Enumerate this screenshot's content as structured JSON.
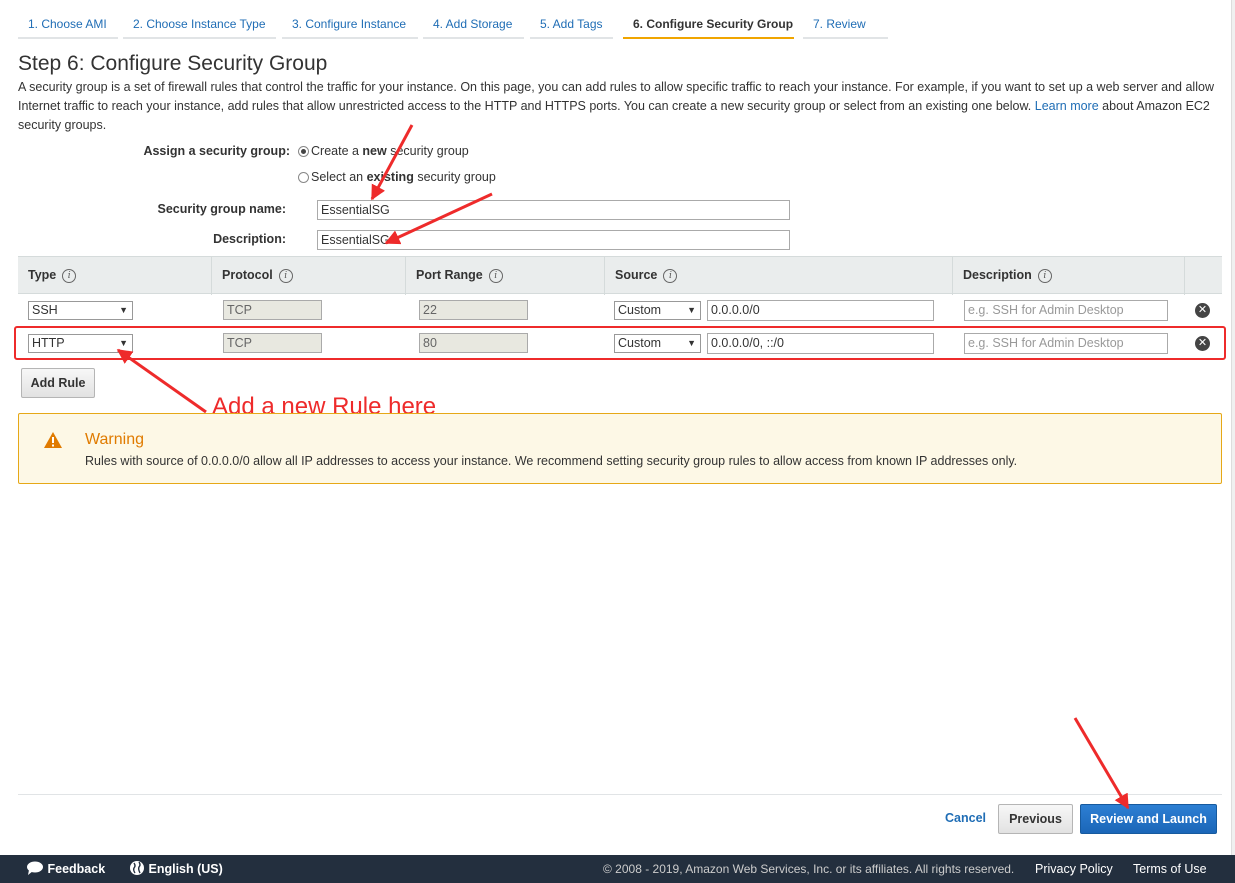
{
  "wizard": {
    "tabs": [
      {
        "label": "1. Choose AMI"
      },
      {
        "label": "2. Choose Instance Type"
      },
      {
        "label": "3. Configure Instance"
      },
      {
        "label": "4. Add Storage"
      },
      {
        "label": "5. Add Tags"
      },
      {
        "label": "6. Configure Security Group"
      },
      {
        "label": "7. Review"
      }
    ],
    "active_tab": 5
  },
  "page": {
    "title": "Step 6: Configure Security Group",
    "intro": "A security group is a set of firewall rules that control the traffic for your instance. On this page, you can add rules to allow specific traffic to reach your instance. For example, if you want to set up a web server and allow Internet traffic to reach your instance, add rules that allow unrestricted access to the HTTP and HTTPS ports. You can create a new security group or select from an existing one below.",
    "learn_more": "Learn more",
    "intro_tail": "about Amazon EC2 security groups."
  },
  "form": {
    "assign_label": "Assign a security group:",
    "option_new_pre": "Create a ",
    "option_new_bold": "new",
    "option_new_post": " security group",
    "option_existing_pre": "Select an ",
    "option_existing_bold": "existing",
    "option_existing_post": " security group",
    "selected_option": "new",
    "name_label": "Security group name:",
    "name_value": "EssentialSG",
    "desc_label": "Description:",
    "desc_value": "EssentialSG"
  },
  "rules": {
    "headers": {
      "type": "Type",
      "protocol": "Protocol",
      "port_range": "Port Range",
      "source": "Source",
      "description": "Description"
    },
    "info_glyph": "i",
    "remove_glyph": "✕",
    "rows": [
      {
        "type": "SSH",
        "protocol": "TCP",
        "port": "22",
        "source_mode": "Custom",
        "source": "0.0.0.0/0",
        "description_placeholder": "e.g. SSH for Admin Desktop"
      },
      {
        "type": "HTTP",
        "protocol": "TCP",
        "port": "80",
        "source_mode": "Custom",
        "source": "0.0.0.0/0, ::/0",
        "description_placeholder": "e.g. SSH for Admin Desktop"
      }
    ],
    "add_rule_label": "Add Rule"
  },
  "annotation": {
    "text": "Add a new Rule here",
    "color": "#ee2b2b"
  },
  "warning": {
    "title": "Warning",
    "text": "Rules with source of 0.0.0.0/0 allow all IP addresses to access your instance. We recommend setting security group rules to allow access from known IP addresses only."
  },
  "actions": {
    "cancel": "Cancel",
    "previous": "Previous",
    "review_launch": "Review and Launch"
  },
  "footer": {
    "feedback": "Feedback",
    "language": "English (US)",
    "copyright": "© 2008 - 2019, Amazon Web Services, Inc. or its affiliates. All rights reserved.",
    "privacy": "Privacy Policy",
    "terms": "Terms of Use"
  },
  "colors": {
    "link": "#1f6db5",
    "active_tab_underline": "#f0a500",
    "warning_border": "#e6a817",
    "warning_title": "#e07b00",
    "primary_button": "#1b66b8",
    "footer_bg": "#232f3e"
  }
}
